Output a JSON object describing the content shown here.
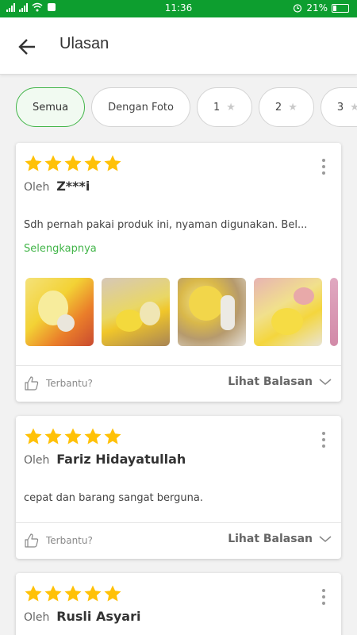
{
  "status_bar": {
    "time": "11:36",
    "battery": "21%",
    "battery_level": 0.21,
    "bg_color": "#0d9e2f"
  },
  "header": {
    "title": "Ulasan",
    "back_icon": "arrow-left-icon"
  },
  "filters": [
    {
      "label": "Semua",
      "active": true,
      "star": false
    },
    {
      "label": "Dengan Foto",
      "active": false,
      "star": false
    },
    {
      "label": "1",
      "active": false,
      "star": true
    },
    {
      "label": "2",
      "active": false,
      "star": true
    },
    {
      "label": "3",
      "active": false,
      "star": true
    }
  ],
  "colors": {
    "accent": "#42b549",
    "star": "#ffc107"
  },
  "reviews": [
    {
      "rating": 5,
      "by_label": "Oleh",
      "author": "Z***i",
      "text": "Sdh pernah pakai produk ini, nyaman digunakan. Bel...",
      "read_more": "Selengkapnya",
      "photo_count_visible": 5,
      "helpful_label": "Terbantu?",
      "replies_label": "Lihat Balasan"
    },
    {
      "rating": 5,
      "by_label": "Oleh",
      "author": "Fariz Hidayatullah",
      "text": "cepat dan barang sangat berguna.",
      "helpful_label": "Terbantu?",
      "replies_label": "Lihat Balasan"
    },
    {
      "rating": 5,
      "by_label": "Oleh",
      "author": "Rusli Asyari"
    }
  ]
}
